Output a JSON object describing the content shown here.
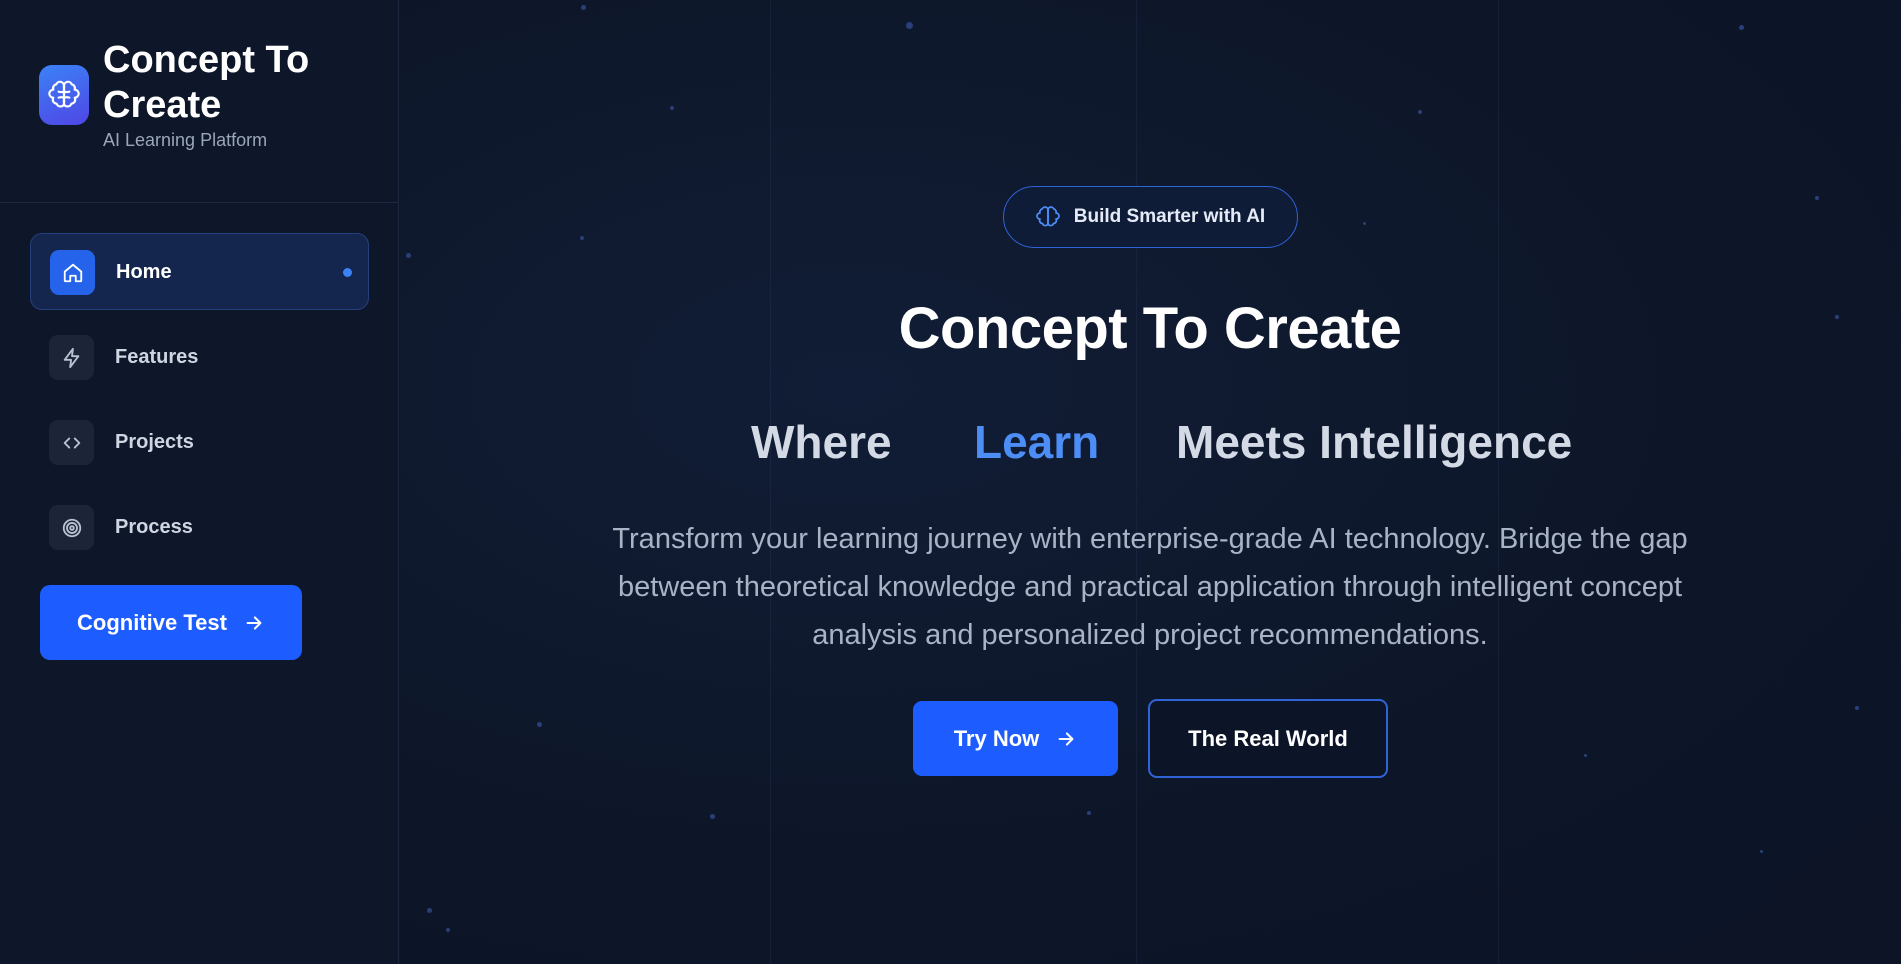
{
  "brand": {
    "title": "Concept To Create",
    "subtitle": "AI Learning Platform",
    "logo_icon": "brain-icon"
  },
  "sidebar": {
    "items": [
      {
        "label": "Home",
        "icon": "home-icon",
        "active": true
      },
      {
        "label": "Features",
        "icon": "lightning-icon",
        "active": false
      },
      {
        "label": "Projects",
        "icon": "code-icon",
        "active": false
      },
      {
        "label": "Process",
        "icon": "target-icon",
        "active": false
      }
    ],
    "cta_label": "Cognitive Test",
    "cta_icon": "arrow-right-icon"
  },
  "hero": {
    "badge": "Build Smarter with AI",
    "badge_icon": "brain-icon",
    "title": "Concept To Create",
    "tagline": [
      "Where",
      "Learn",
      "Meets Intelligence"
    ],
    "description": "Transform your learning journey with enterprise-grade AI technology. Bridge the gap between theoretical knowledge and practical application through intelligent concept analysis and personalized project recommendations.",
    "primary_button": "Try Now",
    "secondary_button": "The Real World"
  },
  "colors": {
    "accent": "#1d5cff",
    "highlight": "#4c8df6",
    "background": "#0d1628"
  }
}
